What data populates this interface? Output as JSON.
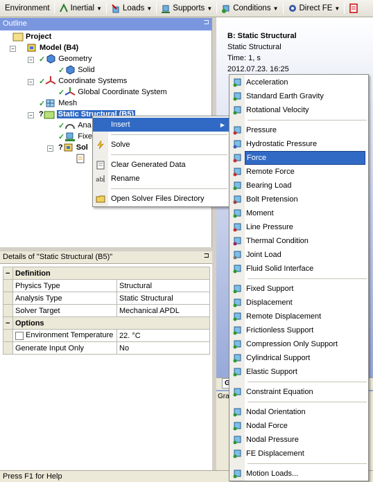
{
  "toolbar": {
    "items": [
      {
        "label": "Environment",
        "icon": "none",
        "has_dropdown": false
      },
      {
        "label": "Inertial",
        "icon": "acceleration-icon",
        "has_dropdown": true
      },
      {
        "label": "Loads",
        "icon": "force-icon",
        "has_dropdown": true
      },
      {
        "label": "Supports",
        "icon": "support-icon",
        "has_dropdown": true
      },
      {
        "label": "Conditions",
        "icon": "conditions-icon",
        "has_dropdown": true
      },
      {
        "label": "Direct FE",
        "icon": "direct-fe-icon",
        "has_dropdown": true
      }
    ]
  },
  "outline": {
    "title": "Outline",
    "tree": {
      "project": "Project",
      "model": "Model (B4)",
      "geometry": "Geometry",
      "solid": "Solid",
      "coordinate_systems": "Coordinate Systems",
      "global_cs": "Global Coordinate System",
      "mesh": "Mesh",
      "static_structural": "Static Structural (B5)",
      "analysis_settings_partial": "Ana",
      "fixed_support_partial": "Fixe",
      "solution_partial": "Sol"
    }
  },
  "context_menu": {
    "items": [
      {
        "label": "Insert",
        "icon": "none",
        "has_submenu": true,
        "highlighted": true
      },
      {
        "label": "Solve",
        "icon": "lightning-icon"
      },
      {
        "label": "Clear Generated Data",
        "icon": "clear-icon"
      },
      {
        "label": "Rename",
        "icon": "rename-icon"
      },
      {
        "label": "Open Solver Files Directory",
        "icon": "folder-icon"
      }
    ]
  },
  "insert_submenu": {
    "groups": [
      [
        {
          "label": "Acceleration",
          "icon": "acceleration-icon"
        },
        {
          "label": "Standard Earth Gravity",
          "icon": "gravity-icon"
        },
        {
          "label": "Rotational Velocity",
          "icon": "rotational-velocity-icon"
        }
      ],
      [
        {
          "label": "Pressure",
          "icon": "pressure-icon"
        },
        {
          "label": "Hydrostatic Pressure",
          "icon": "hydrostatic-pressure-icon"
        },
        {
          "label": "Force",
          "icon": "force-icon",
          "highlighted": true
        },
        {
          "label": "Remote Force",
          "icon": "remote-force-icon"
        },
        {
          "label": "Bearing Load",
          "icon": "bearing-load-icon"
        },
        {
          "label": "Bolt Pretension",
          "icon": "bolt-pretension-icon"
        },
        {
          "label": "Moment",
          "icon": "moment-icon"
        },
        {
          "label": "Line Pressure",
          "icon": "line-pressure-icon"
        },
        {
          "label": "Thermal Condition",
          "icon": "thermal-condition-icon"
        },
        {
          "label": "Joint Load",
          "icon": "joint-load-icon"
        },
        {
          "label": "Fluid Solid Interface",
          "icon": "fluid-solid-interface-icon"
        }
      ],
      [
        {
          "label": "Fixed Support",
          "icon": "fixed-support-icon"
        },
        {
          "label": "Displacement",
          "icon": "displacement-icon"
        },
        {
          "label": "Remote Displacement",
          "icon": "remote-displacement-icon"
        },
        {
          "label": "Frictionless Support",
          "icon": "frictionless-support-icon"
        },
        {
          "label": "Compression Only Support",
          "icon": "compression-only-support-icon"
        },
        {
          "label": "Cylindrical Support",
          "icon": "cylindrical-support-icon"
        },
        {
          "label": "Elastic Support",
          "icon": "elastic-support-icon"
        }
      ],
      [
        {
          "label": "Constraint Equation",
          "icon": "constraint-equation-icon"
        }
      ],
      [
        {
          "label": "Nodal Orientation",
          "icon": "nodal-orientation-icon"
        },
        {
          "label": "Nodal Force",
          "icon": "nodal-force-icon"
        },
        {
          "label": "Nodal Pressure",
          "icon": "nodal-pressure-icon"
        },
        {
          "label": "FE Displacement",
          "icon": "fe-displacement-icon"
        }
      ],
      [
        {
          "label": "Motion Loads...",
          "icon": "motion-loads-icon"
        }
      ]
    ]
  },
  "graphics": {
    "title": "B: Static Structural",
    "subtitle": "Static Structural",
    "time": "Time: 1, s",
    "timestamp": "2012.07.23. 16:25",
    "tab_label": "G",
    "bottom_label": "Gra"
  },
  "details": {
    "title": "Details of \"Static Structural (B5)\"",
    "groups": [
      {
        "name": "Definition",
        "rows": [
          {
            "label": "Physics Type",
            "value": "Structural"
          },
          {
            "label": "Analysis Type",
            "value": "Static Structural"
          },
          {
            "label": "Solver Target",
            "value": "Mechanical APDL"
          }
        ]
      },
      {
        "name": "Options",
        "rows": [
          {
            "label": "Environment Temperature",
            "value": "22. °C",
            "checkbox": true
          },
          {
            "label": "Generate Input Only",
            "value": "No"
          }
        ]
      }
    ]
  },
  "status": {
    "help_text": "Press F1 for Help"
  },
  "colors": {
    "selection": "#316ac5",
    "panel_header": "#7a96df",
    "check_green": "#2f9a2f"
  }
}
